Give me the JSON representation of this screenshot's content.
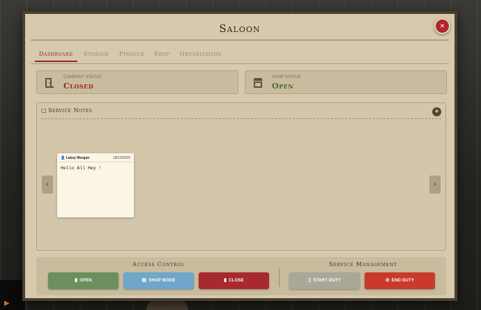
{
  "window": {
    "title": "Saloon",
    "close_icon": "×"
  },
  "tabs": [
    {
      "label": "Dashboard",
      "active": true
    },
    {
      "label": "Storage",
      "active": false
    },
    {
      "label": "Finance",
      "active": false
    },
    {
      "label": "Shop",
      "active": false
    },
    {
      "label": "Organization",
      "active": false
    }
  ],
  "status": {
    "company": {
      "label": "COMPANY STATUS",
      "value": "Closed",
      "icon": "door-icon",
      "color": "#9c2026"
    },
    "shop": {
      "label": "SHOP STATUS",
      "value": "Open",
      "icon": "store-icon",
      "color": "#3f6a2c"
    }
  },
  "service_notes": {
    "title": "Service Notes",
    "add_icon": "+",
    "prev_icon": "‹",
    "next_icon": "›",
    "notes": [
      {
        "author": "Lakey Morgan",
        "date": "18/12/2025",
        "text": "Hello All Hey !"
      }
    ]
  },
  "access_control": {
    "title": "Access Control",
    "open": {
      "label": "OPEN",
      "color": "#6b8f5e"
    },
    "shop_mode": {
      "label": "SHOP MODE",
      "color": "#6fa6c9"
    },
    "close": {
      "label": "CLOSE",
      "color": "#a72a2e"
    }
  },
  "service_management": {
    "title": "Service Management",
    "start_duty": {
      "label": "START DUTY",
      "color": "#a9a798"
    },
    "end_duty": {
      "label": "END DUTY",
      "color": "#c93a2c"
    }
  }
}
